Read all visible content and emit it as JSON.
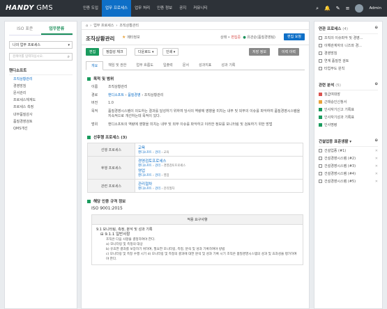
{
  "app": {
    "logo_bold": "HANDY",
    "logo_rest": " GMS",
    "user": "Admin"
  },
  "nav": [
    "인증 도입",
    "업무 프로세스",
    "업무 처리",
    "인증 정보",
    "공지",
    "커뮤니티"
  ],
  "left": {
    "tab1": "ISO 표준",
    "tab2": "업무분류",
    "select": "나의 업무 프로세스",
    "search_placeholder": "검색어를 입력하십시오.",
    "root": "핸디소프트",
    "items": [
      "조직상황관리",
      "경영방침",
      "문서관리",
      "프로세스체계도",
      "프로세스 측정",
      "내부품질감사",
      "품질경영검토",
      "QMS개선"
    ]
  },
  "breadcrumb": [
    "업무 프로세스",
    "조직상황관리"
  ],
  "page": {
    "title": "조직상황관리",
    "mark": "★",
    "mark_label": "메타정보",
    "state_label": "상태 •",
    "state": "편집중",
    "owner": "유관순(품질경영팀)",
    "edit_button": "편집 요청"
  },
  "toolbar": {
    "edit": "편집",
    "check": "정합성 체크",
    "download": "다운로드 ▾",
    "print": "인쇄 ▾",
    "save": "저장 정보",
    "history": "이력 이력"
  },
  "tabs": [
    "개요",
    "책임 및 권한",
    "업무 흐름도",
    "입출력",
    "문서",
    "성과지표",
    "성과 기록"
  ],
  "sections": {
    "overview": "목적 및 범위",
    "preceding": "선후행 프로세스 (3)",
    "iso": "해당 인증 규격 정보"
  },
  "overview": [
    {
      "k": "이름",
      "v": "조직상황관리"
    },
    {
      "k": "경로",
      "v": "조직상황관리"
    },
    {
      "k": "버전",
      "v": "1.0"
    },
    {
      "k": "목적",
      "v": "품질경영시스템이 의도하는 결과를 달성하기 위하여 당사의 역량에 영향을 미치는 내부 및 외부의 이슈를 파악하여 품질경영시스템을 지속적으로 개선하는데 목적이 있다."
    },
    {
      "k": "범위",
      "v": "핸디소프트의 역량에 영향을 미치는 내부 및 외부 이슈를 파악하고 이러한 정보를 모니터링 및 검토하기 위한 방법"
    }
  ],
  "path_links": [
    "핸디소프트",
    "품질경영"
  ],
  "preceding": [
    {
      "h": "선행 프로세스",
      "name": "교육",
      "path": [
        "핸디소프트",
        "관리",
        "교육"
      ]
    },
    {
      "h": "후행 프로세스",
      "name": "경영검토프로세스",
      "path": [
        "핸디소프트",
        "관리",
        "경영검토프로세스"
      ],
      "name2": "영업",
      "path2": [
        "핸디소프트",
        "관리",
        "영업"
      ]
    },
    {
      "h": "관련 프로세스",
      "name": "관리절차",
      "path": [
        "핸디소프트",
        "관리",
        "관리절차"
      ]
    }
  ],
  "iso": {
    "std": "ISO 9001:2015",
    "head": "적용 요구사항",
    "l1": "9.1 모니터링, 측정, 분석 및 성과 기록",
    "l2": "9.1.1 일반사항",
    "l3": "조직은 다음 사항을 결정하여야 한다.",
    "l4": "a) 모니터링 및 측정의 대상",
    "l5": "b) 유효한 결과를 보장하기 위하여, 필요한 모니터링, 측정, 분석 및 성과 기록하여야 방법",
    "l6": "c) 모니터링 및 측정 수행 시기 d) 모니터링 및 측정의 결과에 대한 분석 및 성과 기록 시기 조직은 품질경영시스템의 성과 및 효과성을 평가하여야 한다."
  },
  "right": {
    "related_title": "연관 프로세스",
    "related_count": "(4)",
    "related": [
      "조직의 이슈파악 및 경영...",
      "이해관계자의 니즈와 경...",
      "경영방침",
      "연계 품질전 검토",
      "타업무도 원칙"
    ],
    "cat_title": "관련 분석",
    "cat_count": "(5)",
    "cats": [
      {
        "n": "월급여대장",
        "c": "#d9534f"
      },
      {
        "n": "근태승인신청서",
        "c": "#e8a33d"
      },
      {
        "n": "인사자기신고 기록표",
        "c": "#1a9b5e"
      },
      {
        "n": "인사자기성과 기록표",
        "c": "#1a9b5e"
      },
      {
        "n": "인사명령",
        "c": "#1a9b5e"
      }
    ],
    "std_title": "건설업종 표준생활 ▾",
    "stds": [
      "건설업종 (#1)",
      "건설경영시스템 (#2)",
      "건설경영시스템 (#3)",
      "건설경영시스템 (#4)",
      "건설경영시스템 (#5)"
    ]
  }
}
